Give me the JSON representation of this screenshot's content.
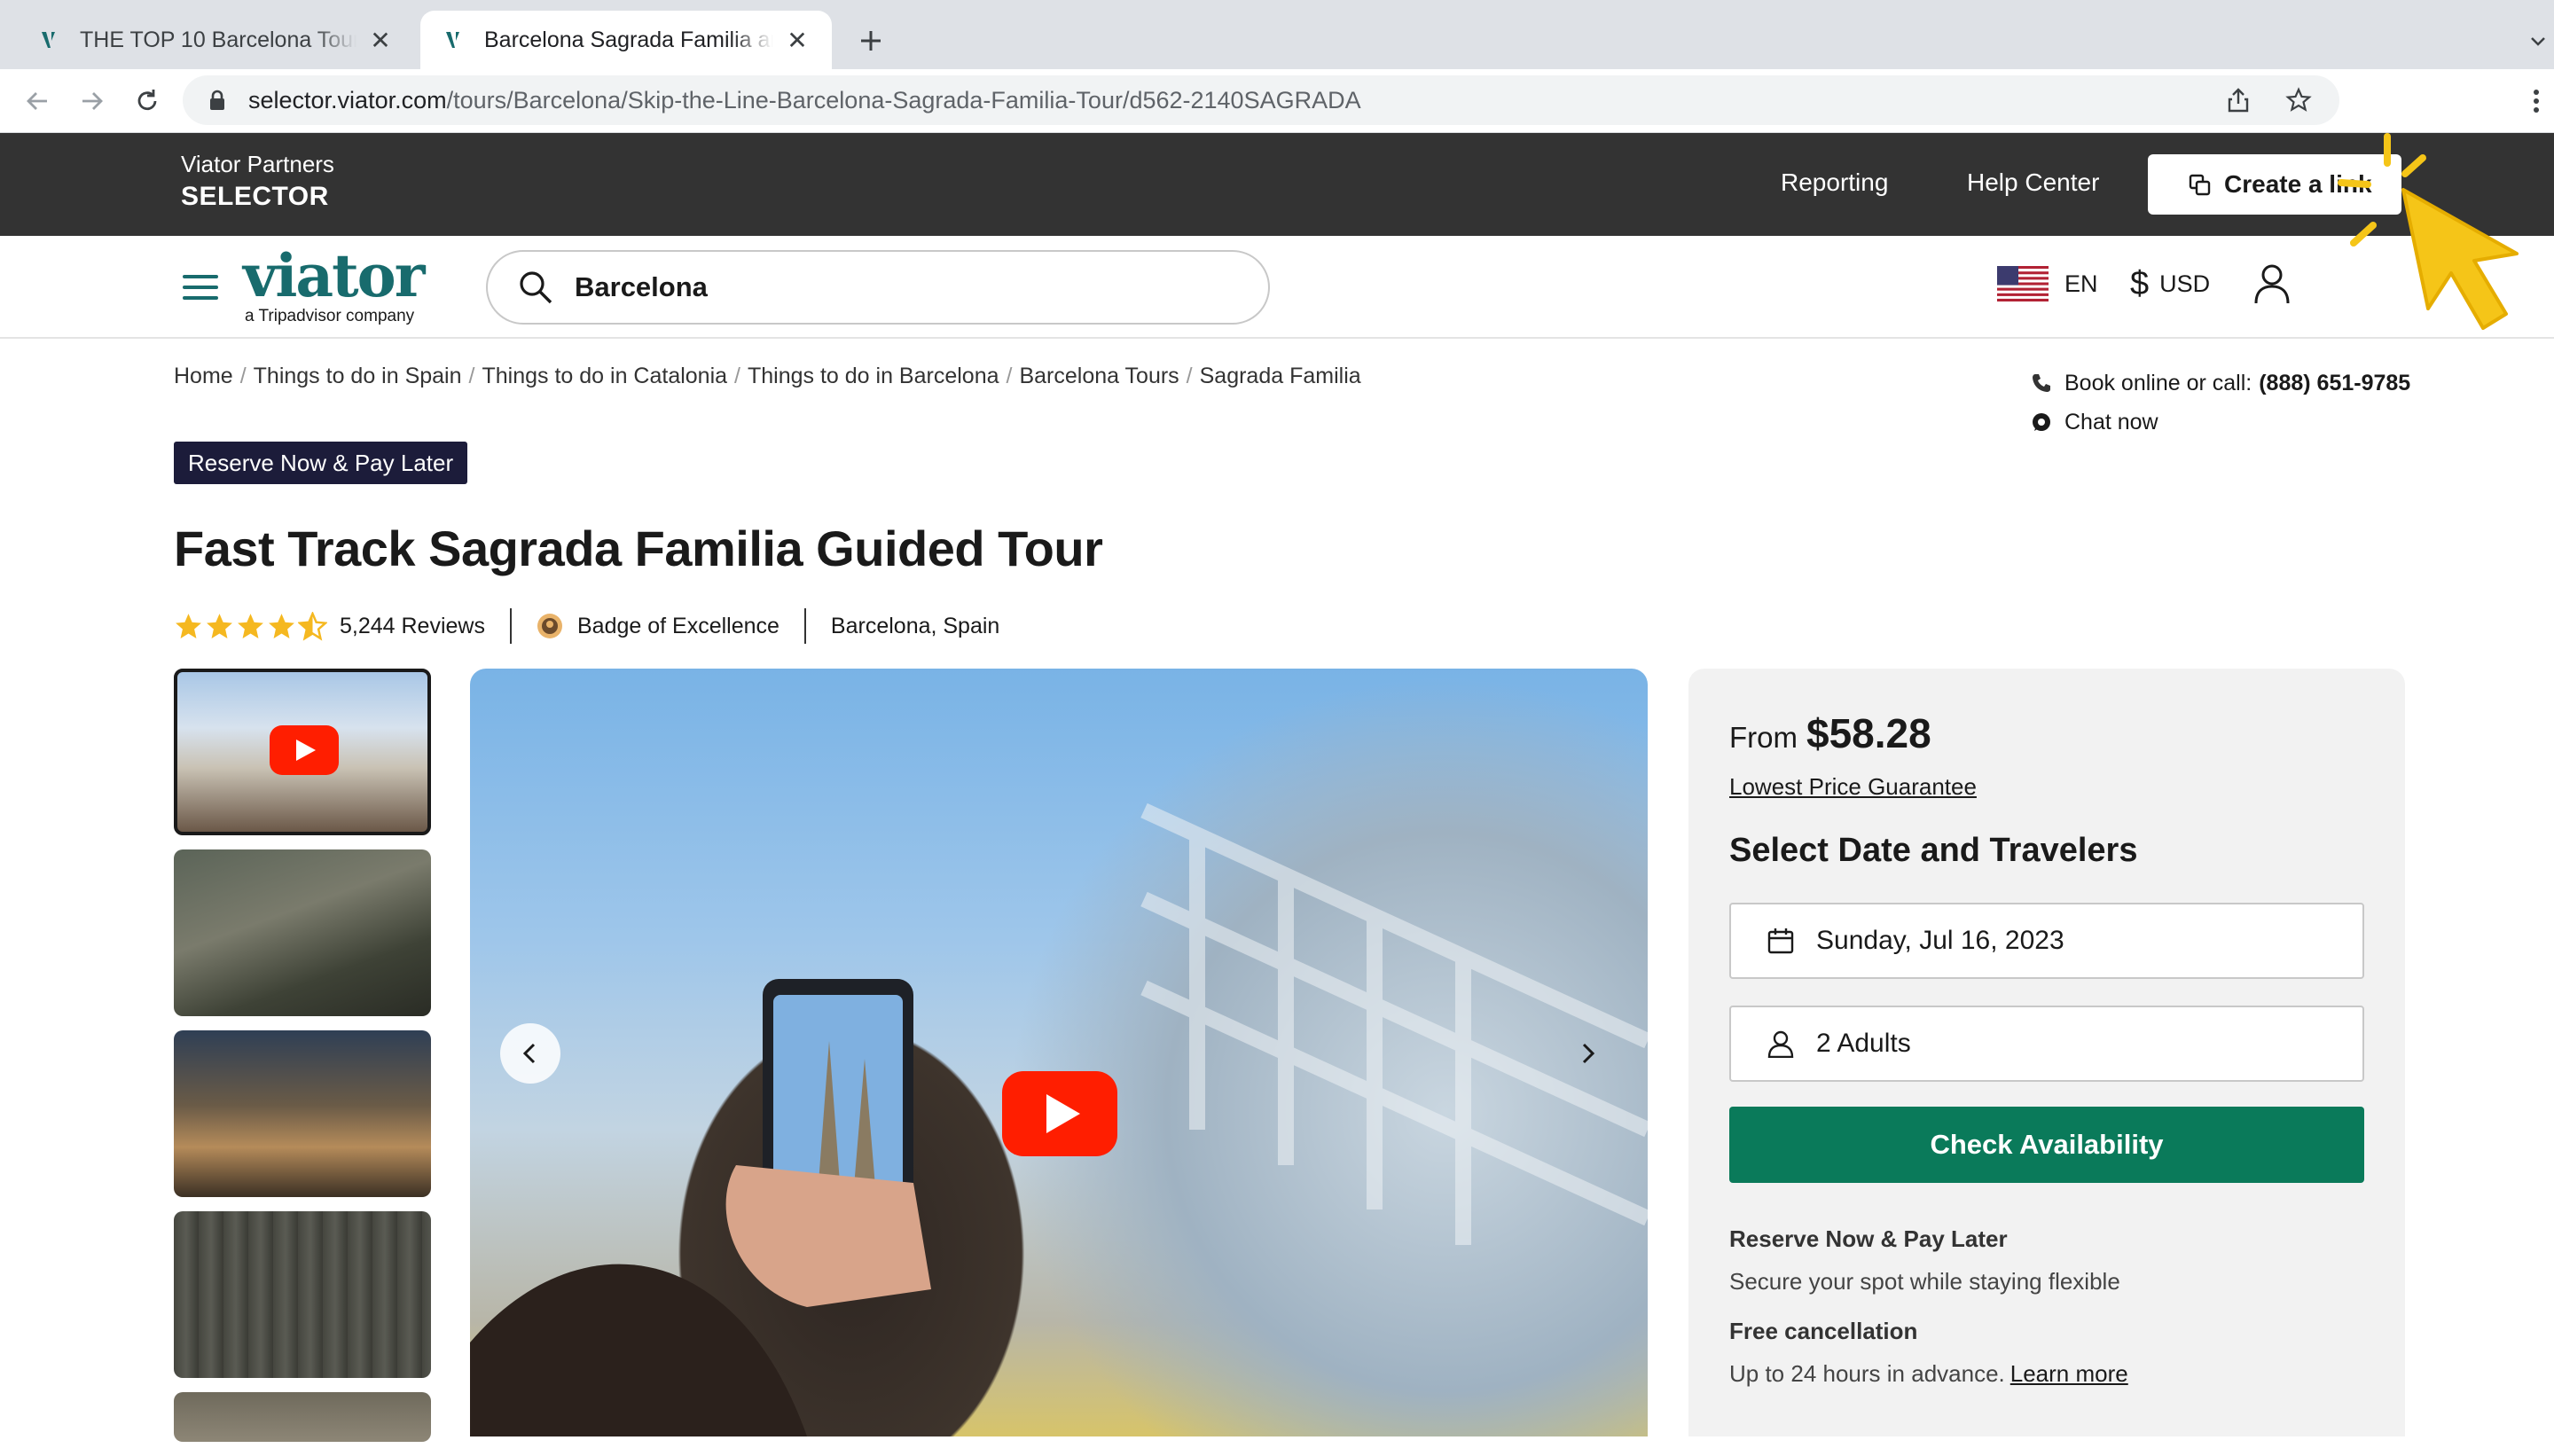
{
  "browser": {
    "tabs": [
      {
        "title": "THE TOP 10 Barcelona Tours &",
        "active": false
      },
      {
        "title": "Barcelona Sagrada Familia and",
        "active": true
      }
    ],
    "url_host": "selector.viator.com",
    "url_path": "/tours/Barcelona/Skip-the-Line-Barcelona-Sagrada-Familia-Tour/d562-2140SAGRADA"
  },
  "partner_bar": {
    "brand_line1": "Viator Partners",
    "brand_line2": "SELECTOR",
    "nav": [
      "Reporting",
      "Help Center"
    ],
    "create_link_label": "Create a link"
  },
  "header": {
    "logo": "viator",
    "logo_sub": "a Tripadvisor company",
    "search_value": "Barcelona",
    "language": "EN",
    "currency": "USD"
  },
  "breadcrumb": [
    "Home",
    "Things to do in Spain",
    "Things to do in Catalonia",
    "Things to do in Barcelona",
    "Barcelona Tours",
    "Sagrada Familia"
  ],
  "contact": {
    "book_text": "Book online or call:",
    "phone": "(888) 651-9785",
    "chat": "Chat now"
  },
  "product": {
    "badge": "Reserve Now & Pay Later",
    "title": "Fast Track Sagrada Familia Guided Tour",
    "rating": 4.5,
    "reviews": "5,244 Reviews",
    "excellence": "Badge of Excellence",
    "location": "Barcelona, Spain"
  },
  "booking": {
    "from_label": "From",
    "price": "$58.28",
    "lowest_price": "Lowest Price Guarantee",
    "heading": "Select Date and Travelers",
    "date": "Sunday, Jul 16, 2023",
    "travelers": "2 Adults",
    "check_button": "Check Availability",
    "reserve_title": "Reserve Now & Pay Later",
    "reserve_body": "Secure your spot while staying flexible",
    "cancel_title": "Free cancellation",
    "cancel_body": "Up to 24 hours in advance.",
    "learn_more": "Learn more"
  },
  "colors": {
    "partner_bar": "#333333",
    "brand_green": "#186b6d",
    "cta_green": "#0a7a5a",
    "badge_navy": "#1c1c3a",
    "star": "#f5b820"
  }
}
